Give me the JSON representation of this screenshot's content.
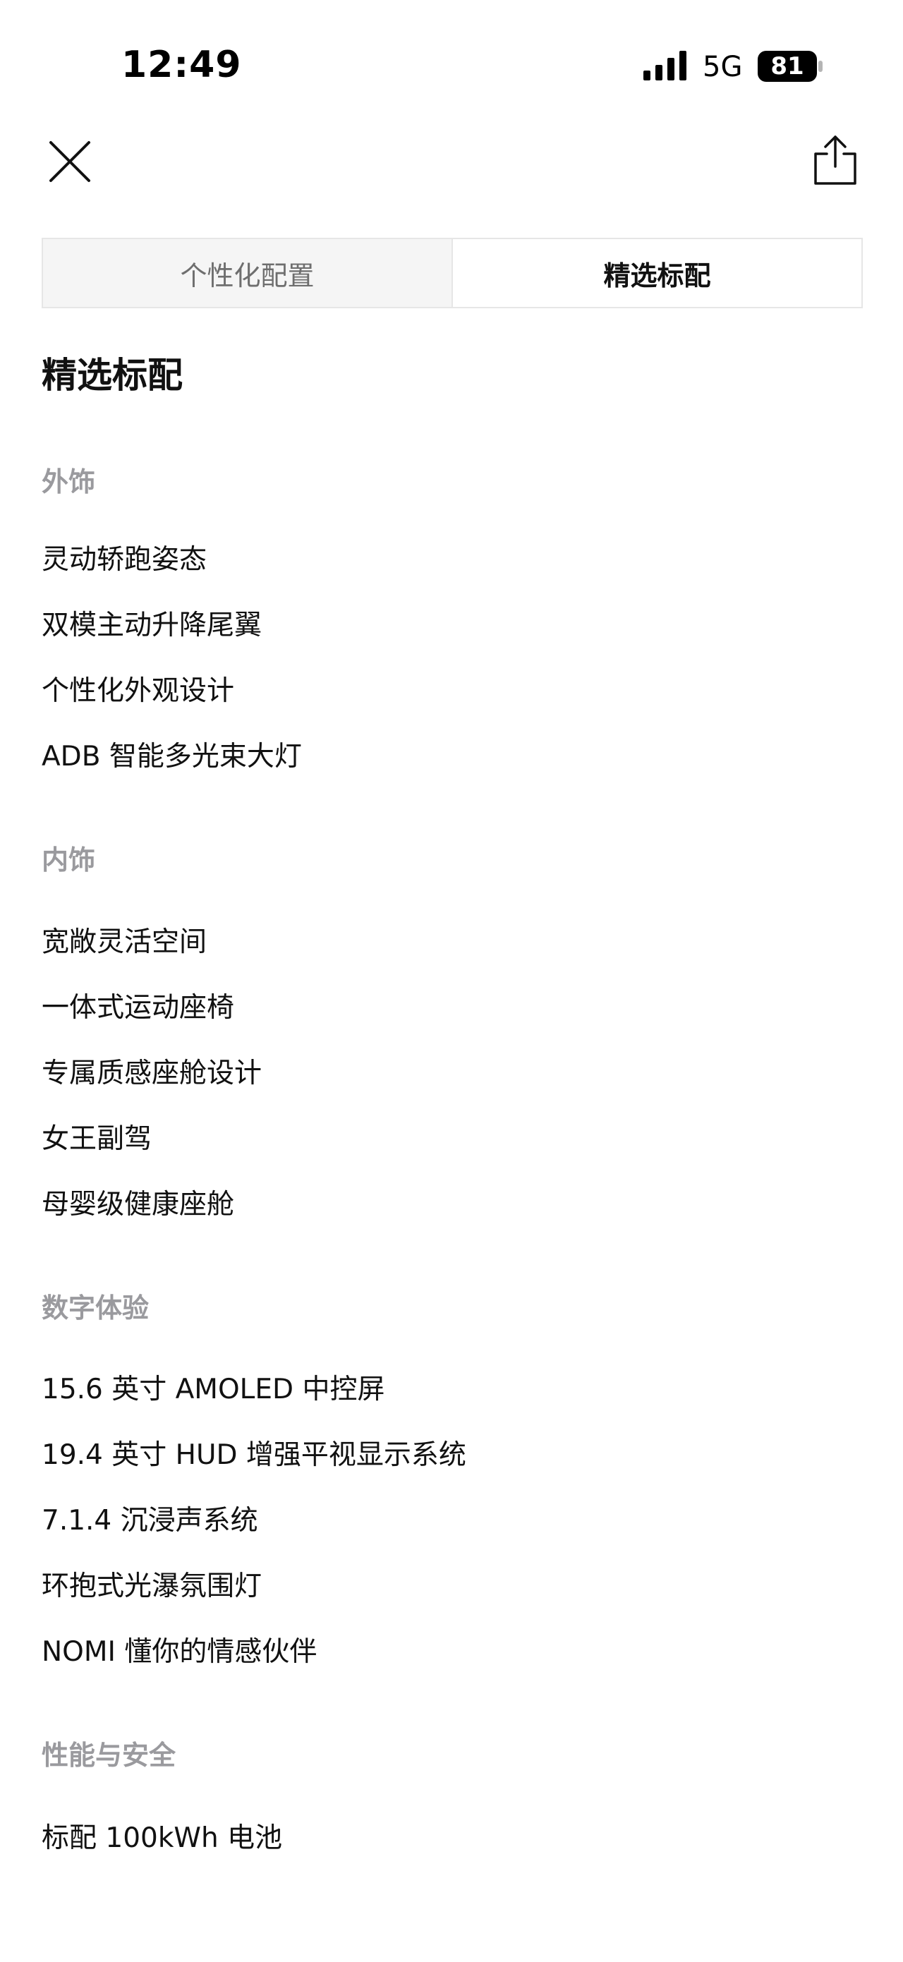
{
  "status_bar": {
    "time": "12:49",
    "network": "5G",
    "battery": "81"
  },
  "icons": {
    "close": "close-icon",
    "share": "share-icon"
  },
  "tabs": [
    {
      "label": "个性化配置",
      "active": false
    },
    {
      "label": "精选标配",
      "active": true
    }
  ],
  "page_title": "精选标配",
  "sections": [
    {
      "header": "外饰",
      "items": [
        "灵动轿跑姿态",
        "双模主动升降尾翼",
        "个性化外观设计",
        "ADB 智能多光束大灯"
      ]
    },
    {
      "header": "内饰",
      "items": [
        "宽敞灵活空间",
        "一体式运动座椅",
        "专属质感座舱设计",
        "女王副驾",
        "母婴级健康座舱"
      ]
    },
    {
      "header": "数字体验",
      "items": [
        "15.6 英寸 AMOLED 中控屏",
        "19.4 英寸 HUD 增强平视显示系统",
        "7.1.4 沉浸声系统",
        "环抱式光瀑氛围灯",
        "NOMI 懂你的情感伙伴"
      ]
    },
    {
      "header": "性能与安全",
      "items": [
        "标配 100kWh 电池"
      ]
    }
  ]
}
